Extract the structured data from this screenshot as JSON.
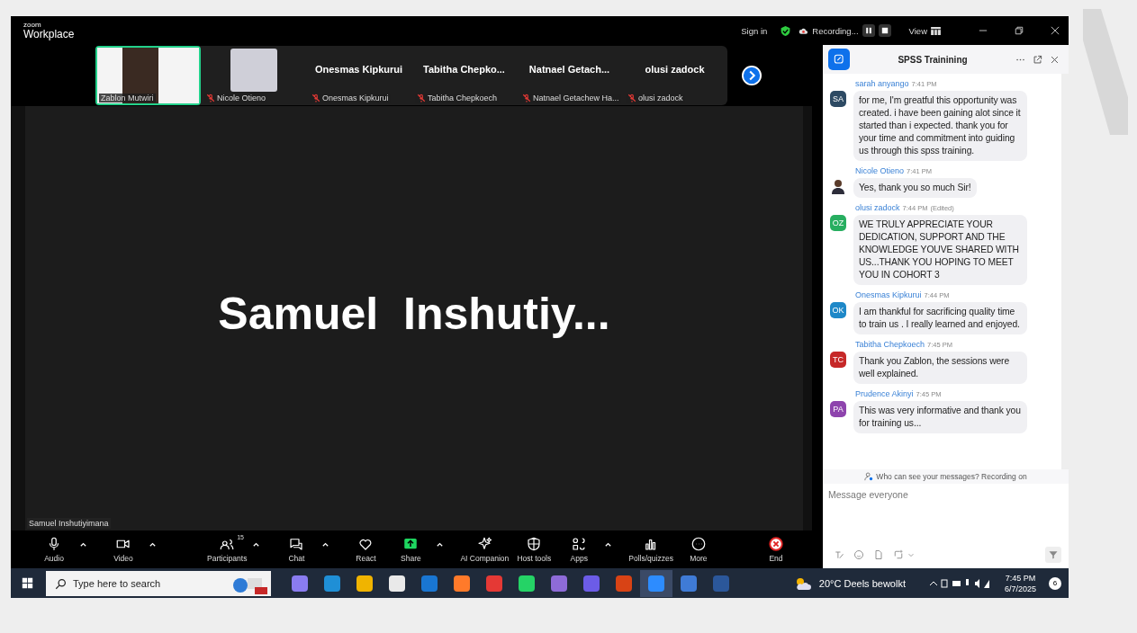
{
  "window": {
    "brand_top": "zoom",
    "brand": "Workplace",
    "sign_in": "Sign in",
    "recording": "Recording...",
    "view": "View"
  },
  "thumbnails": [
    {
      "kind": "video",
      "name": "Zablon Mutwiri",
      "speaking": true,
      "muted": false
    },
    {
      "kind": "photo",
      "name": "Nicole Otieno",
      "speaking": false,
      "muted": true
    },
    {
      "kind": "name",
      "title": "Onesmas Kipkurui",
      "name": "Onesmas Kipkurui",
      "speaking": false,
      "muted": true
    },
    {
      "kind": "name",
      "title": "Tabitha  Chepko...",
      "name": "Tabitha Chepkoech",
      "speaking": false,
      "muted": true
    },
    {
      "kind": "name",
      "title": "Natnael  Getach...",
      "name": "Natnael Getachew Ha...",
      "speaking": false,
      "muted": true
    },
    {
      "kind": "name",
      "title": "olusi zadock",
      "name": "olusi zadock",
      "speaking": false,
      "muted": true
    }
  ],
  "stage": {
    "speaker": "Samuel  Inshutiy...",
    "name_label": "Samuel Inshutiyimana"
  },
  "toolbar": [
    {
      "kind": "tool",
      "label": "Audio",
      "caret": true
    },
    {
      "kind": "tool",
      "label": "Video",
      "caret": true
    },
    {
      "kind": "tool",
      "label": "Participants",
      "caret": true,
      "badge": "15"
    },
    {
      "kind": "tool",
      "label": "Chat",
      "caret": true
    },
    {
      "kind": "tool",
      "label": "React",
      "caret": false
    },
    {
      "kind": "share",
      "label": "Share",
      "caret": true
    },
    {
      "kind": "tool",
      "label": "AI Companion",
      "caret": false
    },
    {
      "kind": "tool",
      "label": "Host tools",
      "caret": false
    },
    {
      "kind": "tool",
      "label": "Apps",
      "caret": true
    },
    {
      "kind": "tool",
      "label": "Polls/quizzes",
      "caret": false
    },
    {
      "kind": "tool",
      "label": "More",
      "caret": false
    },
    {
      "kind": "end",
      "label": "End",
      "caret": false
    }
  ],
  "chat": {
    "title": "SPSS Trainining",
    "messages": [
      {
        "kind": "initials",
        "initials": "SA",
        "color": "#2d4a63",
        "sender": "sarah anyango",
        "time": "7:41 PM",
        "text": "for me, I'm greatful this opportunity was created. i have been gaining alot since it started than i expected. thank you for your time and commitment into guiding us through this spss training."
      },
      {
        "kind": "photo",
        "sender": "Nicole Otieno",
        "time": "7:41 PM",
        "text": "Yes, thank you so much Sir!"
      },
      {
        "kind": "initials",
        "initials": "OZ",
        "color": "#27ae60",
        "sender": "olusi zadock",
        "time": "7:44 PM",
        "edited": "(Edited)",
        "text": "WE TRULY APPRECIATE YOUR DEDICATION, SUPPORT AND THE KNOWLEDGE YOUVE SHARED WITH US...THANK YOU HOPING TO MEET YOU IN COHORT 3"
      },
      {
        "kind": "initials",
        "initials": "OK",
        "color": "#1e88c8",
        "sender": "Onesmas Kipkurui",
        "time": "7:44 PM",
        "text": "I am thankful for sacrificing quality time to train us . I really learned and enjoyed."
      },
      {
        "kind": "initials",
        "initials": "TC",
        "color": "#c62828",
        "sender": "Tabitha Chepkoech",
        "time": "7:45 PM",
        "text": "Thank you Zablon, the sessions were well explained."
      },
      {
        "kind": "initials",
        "initials": "PA",
        "color": "#8e44ad",
        "sender": "Prudence Akinyi",
        "time": "7:45 PM",
        "text": "This was very informative and thank you for training us..."
      }
    ],
    "notice": "Who can see your messages? Recording on",
    "input": {
      "placeholder": "Message everyone"
    }
  },
  "taskbar": {
    "search": {
      "placeholder": "Type here to search"
    },
    "weather": "20°C  Deels bewolkt",
    "time": "7:45 PM",
    "date": "6/7/2025",
    "notifications": "6"
  }
}
